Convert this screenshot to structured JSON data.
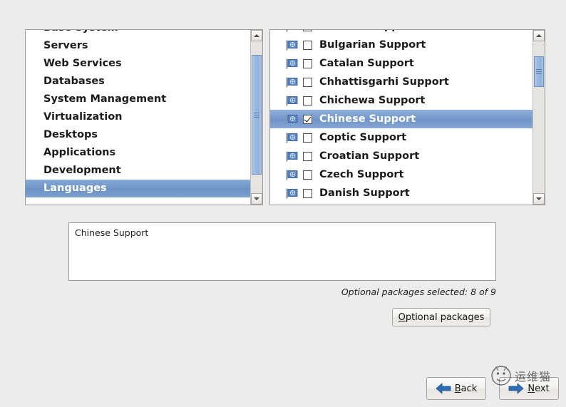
{
  "groups": {
    "scroll": {
      "thumb_top_pct": 9,
      "thumb_height_pct": 79
    },
    "items": [
      {
        "label": "Base System",
        "selected": false
      },
      {
        "label": "Servers",
        "selected": false
      },
      {
        "label": "Web Services",
        "selected": false
      },
      {
        "label": "Databases",
        "selected": false
      },
      {
        "label": "System Management",
        "selected": false
      },
      {
        "label": "Virtualization",
        "selected": false
      },
      {
        "label": "Desktops",
        "selected": false
      },
      {
        "label": "Applications",
        "selected": false
      },
      {
        "label": "Development",
        "selected": false
      },
      {
        "label": "Languages",
        "selected": true
      }
    ]
  },
  "packages": {
    "scroll": {
      "thumb_top_pct": 10,
      "thumb_height_pct": 20
    },
    "icon": "flag-icon",
    "items": [
      {
        "label": "Bosnian Support",
        "checked": false,
        "selected": false,
        "clipped": true
      },
      {
        "label": "Bulgarian Support",
        "checked": false,
        "selected": false
      },
      {
        "label": "Catalan Support",
        "checked": false,
        "selected": false
      },
      {
        "label": "Chhattisgarhi Support",
        "checked": false,
        "selected": false
      },
      {
        "label": "Chichewa Support",
        "checked": false,
        "selected": false
      },
      {
        "label": "Chinese Support",
        "checked": true,
        "selected": true
      },
      {
        "label": "Coptic Support",
        "checked": false,
        "selected": false
      },
      {
        "label": "Croatian Support",
        "checked": false,
        "selected": false
      },
      {
        "label": "Czech Support",
        "checked": false,
        "selected": false
      },
      {
        "label": "Danish Support",
        "checked": false,
        "selected": false
      }
    ]
  },
  "description": {
    "text": "Chinese Support"
  },
  "status": {
    "optional_packages_count": "Optional packages selected: 8 of 9"
  },
  "buttons": {
    "optional_packages": {
      "mnemonic": "O",
      "rest": "ptional packages"
    },
    "back": {
      "mnemonic": "B",
      "rest": "ack",
      "icon": "arrow-left-icon"
    },
    "next": {
      "mnemonic": "N",
      "rest": "ext",
      "icon": "arrow-right-icon"
    }
  },
  "watermark": {
    "text": "运维猫",
    "logo": "circle-logo-icon"
  },
  "colors": {
    "selection_blue": "#7499cb",
    "arrow_blue": "#2e6db4",
    "window_bg": "#ececec",
    "list_bg": "#ffffff"
  }
}
